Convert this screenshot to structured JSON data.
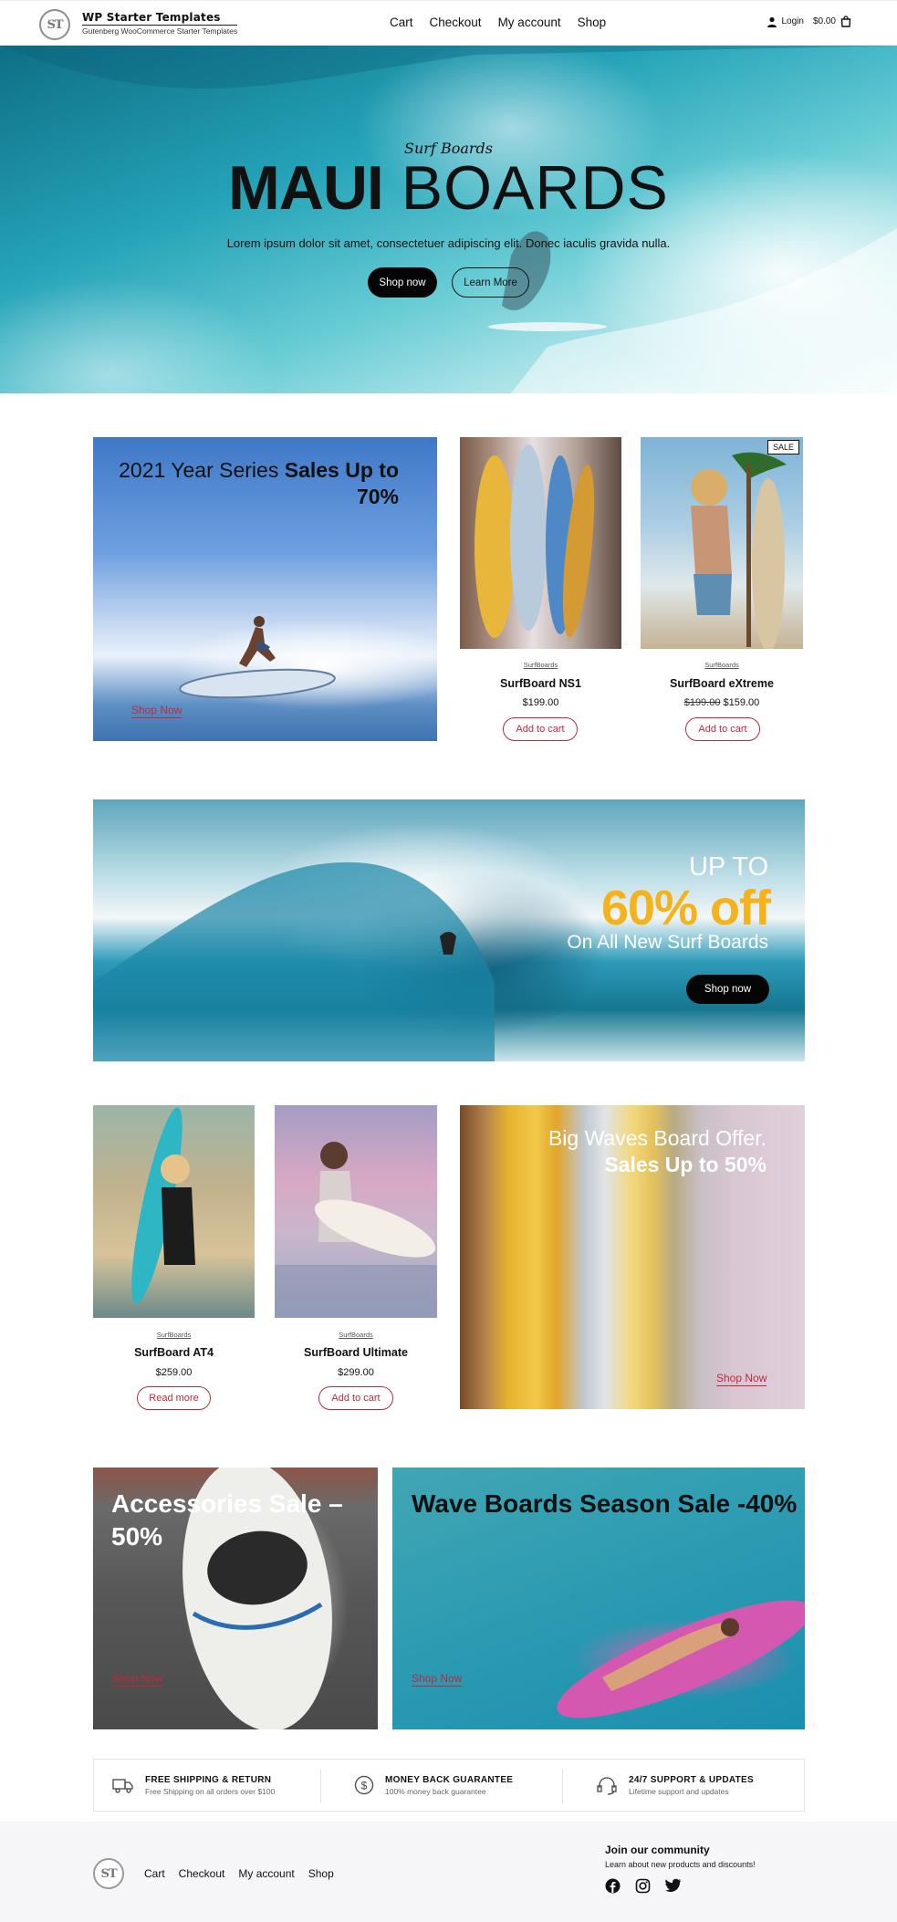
{
  "header": {
    "logo_text": "ST",
    "brand_title": "WP Starter Templates",
    "brand_subtitle": "Gutenberg WooCommerce Starter Templates",
    "nav": [
      "Cart",
      "Checkout",
      "My account",
      "Shop"
    ],
    "login_label": "Login",
    "cart_total": "$0.00"
  },
  "hero": {
    "subtitle": "Surf Boards",
    "title_bold": "MAUI",
    "title_light": "BOARDS",
    "description": "Lorem ipsum dolor sit amet, consectetuer adipiscing elit. Donec iaculis gravida nulla.",
    "primary_button": "Shop now",
    "secondary_button": "Learn More"
  },
  "promo_series": {
    "title_light": "2021 Year Series ",
    "title_bold": "Sales Up to 70%",
    "link": "Shop Now"
  },
  "products_row1": [
    {
      "category": "SurfBoards",
      "name": "SurfBoard NS1",
      "price": "$199.00",
      "old_price": "",
      "button": "Add to cart",
      "badge": ""
    },
    {
      "category": "SurfBoards",
      "name": "SurfBoard eXtreme",
      "price": "$159.00",
      "old_price": "$199.00",
      "button": "Add to cart",
      "badge": "SALE"
    }
  ],
  "banner": {
    "line1": "UP TO",
    "line2": "60% off",
    "line3": "On All New Surf Boards",
    "button": "Shop now"
  },
  "products_row2": [
    {
      "category": "SurfBoards",
      "name": "SurfBoard AT4",
      "price": "$259.00",
      "button": "Read more"
    },
    {
      "category": "SurfBoards",
      "name": "SurfBoard Ultimate",
      "price": "$299.00",
      "button": "Add to cart"
    }
  ],
  "promo_bigwave": {
    "title_light": "Big Waves Board Offer.",
    "title_bold": "Sales Up to 50%",
    "link": "Shop Now"
  },
  "promo_accessories": {
    "title": "Accessories Sale – 50%",
    "link": "Shop Now"
  },
  "promo_waveboards": {
    "title": "Wave Boards Season Sale -40%",
    "link": "Shop Now"
  },
  "features": [
    {
      "icon": "truck-icon",
      "title": "FREE SHIPPING & RETURN",
      "subtitle": "Free Shipping on all orders over $100"
    },
    {
      "icon": "dollar-coin-icon",
      "title": "MONEY BACK GUARANTEE",
      "subtitle": "100% money back guarantee"
    },
    {
      "icon": "headset-icon",
      "title": "24/7 SUPPORT & UPDATES",
      "subtitle": "Lifetime support and updates"
    }
  ],
  "footer": {
    "logo_text": "ST",
    "nav": [
      "Cart",
      "Checkout",
      "My account",
      "Shop"
    ],
    "join_title": "Join our community",
    "join_subtitle": "Learn about new products and discounts!",
    "socials": [
      "facebook-icon",
      "instagram-icon",
      "twitter-icon"
    ]
  },
  "colors": {
    "accent_red": "#c0293a",
    "sale_orange": "#f6b21a",
    "dark": "#050505"
  }
}
